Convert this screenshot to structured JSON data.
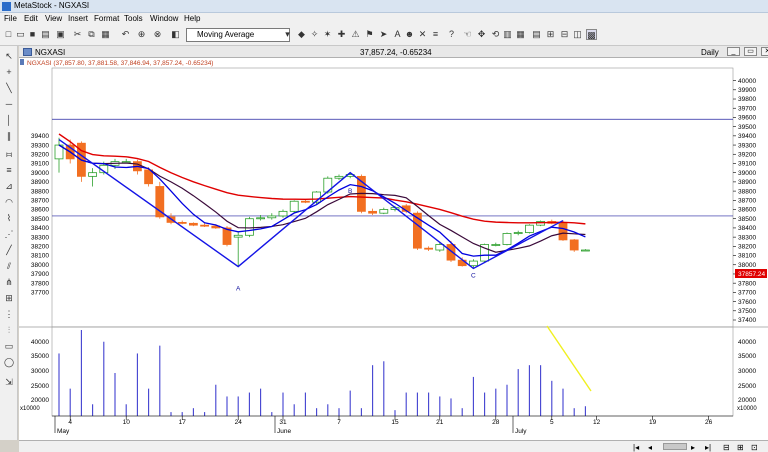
{
  "window": {
    "title": "MetaStock - NGXASI"
  },
  "menu": [
    "File",
    "Edit",
    "View",
    "Insert",
    "Format",
    "Tools",
    "Window",
    "Help"
  ],
  "toolbar": {
    "indicator": "Moving Average"
  },
  "chart_window": {
    "symbol": "NGXASI",
    "period": "Daily"
  },
  "price_header": "NGXASI (37,857.80, 37,881.58, 37,846.94, 37,857.24, -0.65234)",
  "info_line": "37,857.24, -0.65234",
  "current_price": "37857.24",
  "volume_scale_label": "x10000",
  "colors": {
    "up": "#2ca02c",
    "down": "#f26f21",
    "ma_red": "#e00000",
    "ma_blue": "#0000e0",
    "ma_purple": "#3a0a3a",
    "zigzag": "#1414e6",
    "volume": "#4040d0",
    "trendline": "#f0f020"
  },
  "chart_data": {
    "type": "candlestick",
    "series": [
      {
        "name": "price",
        "candles": [
          {
            "o": 39150,
            "h": 39380,
            "l": 39000,
            "c": 39300
          },
          {
            "o": 39300,
            "h": 39360,
            "l": 39100,
            "c": 39150
          },
          {
            "o": 39320,
            "h": 39340,
            "l": 38900,
            "c": 38960
          },
          {
            "o": 38960,
            "h": 39050,
            "l": 38850,
            "c": 39000
          },
          {
            "o": 39000,
            "h": 39120,
            "l": 38980,
            "c": 39080
          },
          {
            "o": 39080,
            "h": 39150,
            "l": 39040,
            "c": 39120
          },
          {
            "o": 39120,
            "h": 39150,
            "l": 39100,
            "c": 39120
          },
          {
            "o": 39120,
            "h": 39140,
            "l": 38980,
            "c": 39020
          },
          {
            "o": 39030,
            "h": 39060,
            "l": 38850,
            "c": 38880
          },
          {
            "o": 38850,
            "h": 38900,
            "l": 38500,
            "c": 38520
          },
          {
            "o": 38520,
            "h": 38560,
            "l": 38440,
            "c": 38460
          },
          {
            "o": 38460,
            "h": 38480,
            "l": 38440,
            "c": 38450
          },
          {
            "o": 38450,
            "h": 38460,
            "l": 38420,
            "c": 38430
          },
          {
            "o": 38430,
            "h": 38450,
            "l": 38410,
            "c": 38420
          },
          {
            "o": 38420,
            "h": 38440,
            "l": 38390,
            "c": 38400
          },
          {
            "o": 38400,
            "h": 38420,
            "l": 38200,
            "c": 38220
          },
          {
            "o": 38300,
            "h": 38360,
            "l": 37980,
            "c": 38320
          },
          {
            "o": 38320,
            "h": 38520,
            "l": 38300,
            "c": 38500
          },
          {
            "o": 38500,
            "h": 38540,
            "l": 38480,
            "c": 38510
          },
          {
            "o": 38510,
            "h": 38560,
            "l": 38490,
            "c": 38530
          },
          {
            "o": 38530,
            "h": 38600,
            "l": 38510,
            "c": 38580
          },
          {
            "o": 38580,
            "h": 38700,
            "l": 38560,
            "c": 38690
          },
          {
            "o": 38690,
            "h": 38710,
            "l": 38670,
            "c": 38680
          },
          {
            "o": 38680,
            "h": 38800,
            "l": 38660,
            "c": 38790
          },
          {
            "o": 38790,
            "h": 38960,
            "l": 38770,
            "c": 38940
          },
          {
            "o": 38940,
            "h": 38980,
            "l": 38920,
            "c": 38960
          },
          {
            "o": 38960,
            "h": 39000,
            "l": 38940,
            "c": 38980
          },
          {
            "o": 38960,
            "h": 38980,
            "l": 38560,
            "c": 38580
          },
          {
            "o": 38580,
            "h": 38610,
            "l": 38540,
            "c": 38560
          },
          {
            "o": 38560,
            "h": 38620,
            "l": 38550,
            "c": 38600
          },
          {
            "o": 38600,
            "h": 38640,
            "l": 38580,
            "c": 38620
          },
          {
            "o": 38640,
            "h": 38660,
            "l": 38560,
            "c": 38580
          },
          {
            "o": 38560,
            "h": 38580,
            "l": 38160,
            "c": 38180
          },
          {
            "o": 38180,
            "h": 38200,
            "l": 38150,
            "c": 38170
          },
          {
            "o": 38160,
            "h": 38250,
            "l": 38140,
            "c": 38220
          },
          {
            "o": 38220,
            "h": 38260,
            "l": 38030,
            "c": 38050
          },
          {
            "o": 38050,
            "h": 38080,
            "l": 37980,
            "c": 37990
          },
          {
            "o": 37990,
            "h": 38060,
            "l": 37960,
            "c": 38040
          },
          {
            "o": 38040,
            "h": 38230,
            "l": 38020,
            "c": 38220
          },
          {
            "o": 38220,
            "h": 38240,
            "l": 38200,
            "c": 38220
          },
          {
            "o": 38220,
            "h": 38350,
            "l": 38210,
            "c": 38340
          },
          {
            "o": 38340,
            "h": 38370,
            "l": 38320,
            "c": 38350
          },
          {
            "o": 38350,
            "h": 38440,
            "l": 38340,
            "c": 38430
          },
          {
            "o": 38430,
            "h": 38480,
            "l": 38420,
            "c": 38470
          },
          {
            "o": 38470,
            "h": 38490,
            "l": 38440,
            "c": 38450
          },
          {
            "o": 38460,
            "h": 38480,
            "l": 38260,
            "c": 38270
          },
          {
            "o": 38270,
            "h": 38280,
            "l": 38140,
            "c": 38160
          },
          {
            "o": 38160,
            "h": 38170,
            "l": 38150,
            "c": 38160
          }
        ]
      },
      {
        "name": "volume",
        "values": [
          32,
          14,
          44,
          6,
          38,
          22,
          6,
          32,
          14,
          36,
          2,
          2,
          4,
          2,
          16,
          10,
          10,
          12,
          14,
          2,
          12,
          6,
          12,
          4,
          6,
          4,
          13,
          4,
          26,
          28,
          3,
          12,
          12,
          12,
          10,
          9,
          4,
          20,
          12,
          14,
          16,
          24,
          26,
          26,
          18,
          14,
          4,
          5
        ]
      }
    ],
    "x_tick_labels": [
      "4",
      "10",
      "17",
      "24",
      "31",
      "7",
      "15",
      "21",
      "28",
      "5",
      "12",
      "19",
      "26"
    ],
    "month_labels": [
      "May",
      "June",
      "July"
    ],
    "y_ticks": [
      37400,
      37500,
      37600,
      37700,
      37800,
      37900,
      38000,
      38100,
      38200,
      38300,
      38400,
      38500,
      38600,
      38700,
      38800,
      38900,
      39000,
      39100,
      39200,
      39300,
      39400,
      39500,
      39600,
      39700,
      39800,
      39900,
      40000
    ],
    "left_ticks": [
      37700,
      37800,
      37900,
      38000,
      38100,
      38200,
      38300,
      38400,
      38500,
      38600,
      38700,
      38800,
      38900,
      39000,
      39100,
      39200,
      39300,
      39400
    ],
    "ylim": [
      37400,
      40050
    ],
    "volume_ticks": [
      20000,
      25000,
      30000,
      35000,
      40000
    ],
    "horizontal_lines": [
      39580,
      38530
    ],
    "wave_labels": [
      "A",
      "B",
      "C"
    ]
  }
}
